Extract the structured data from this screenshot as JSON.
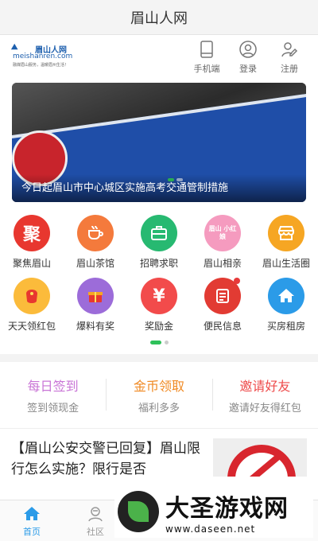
{
  "title": "眉山人网",
  "logo": {
    "cn": "眉山人网",
    "en": "meishanren.com",
    "slogan": "融媒眉山服务，温暖眉州生活！"
  },
  "header_actions": [
    {
      "label": "手机端",
      "icon": "mobile-icon"
    },
    {
      "label": "登录",
      "icon": "user-icon"
    },
    {
      "label": "注册",
      "icon": "register-icon"
    }
  ],
  "banner": {
    "caption": "今日起眉山市中心城区实施高考交通管制措施"
  },
  "grid": [
    {
      "label": "聚焦眉山",
      "icon": "focus-icon",
      "glyph": "聚",
      "color": "#e8372f"
    },
    {
      "label": "眉山茶馆",
      "icon": "tea-cup-icon",
      "color": "#f47a3c"
    },
    {
      "label": "招聘求职",
      "icon": "briefcase-icon",
      "color": "#27b971"
    },
    {
      "label": "眉山相亲",
      "icon": "heart-icon",
      "glyph": "眉山 小红娘",
      "color": "#f59bbf"
    },
    {
      "label": "眉山生活圈",
      "icon": "shop-icon",
      "color": "#f6a623"
    },
    {
      "label": "天天领红包",
      "icon": "red-packet-icon",
      "color": "#fbbb3b"
    },
    {
      "label": "爆料有奖",
      "icon": "gift-icon",
      "color": "#9c6cd9"
    },
    {
      "label": "奖励金",
      "icon": "yen-icon",
      "glyph": "¥",
      "color": "#f24b4b"
    },
    {
      "label": "便民信息",
      "icon": "list-icon",
      "color": "#e23b33"
    },
    {
      "label": "买房租房",
      "icon": "house-icon",
      "color": "#2b9be8"
    }
  ],
  "tasks": [
    {
      "title": "每日签到",
      "sub": "签到领现金",
      "color": "#c975d6"
    },
    {
      "title": "金币领取",
      "sub": "福利多多",
      "color": "#f08a24"
    },
    {
      "title": "邀请好友",
      "sub": "邀请好友得红包",
      "color": "#ee4b4b"
    }
  ],
  "news": {
    "headline": "【眉山公安交警已回复】眉山限行怎么实施？限行是否"
  },
  "tabs": [
    {
      "label": "首页",
      "icon": "home-icon",
      "active": true
    },
    {
      "label": "社区",
      "icon": "community-icon",
      "active": false
    }
  ],
  "watermark": {
    "name": "大圣游戏网",
    "url": "www.daseen.net"
  },
  "colors": {
    "active": "#2b9be8",
    "green": "#2ec15a"
  }
}
